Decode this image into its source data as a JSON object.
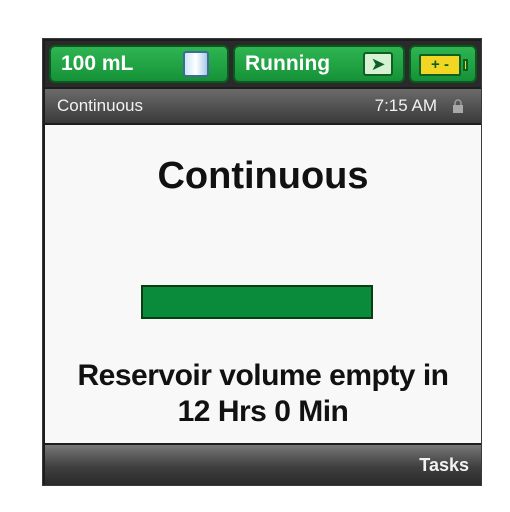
{
  "status_bar": {
    "volume": "100 mL",
    "volume_icon": "reservoir-icon",
    "state": "Running",
    "state_icon": "running-icon",
    "battery_icon": "battery-icon",
    "battery_symbols": "+ -"
  },
  "title_bar": {
    "mode": "Continuous",
    "time": "7:15 AM",
    "lock_icon": "lock-icon"
  },
  "main": {
    "heading": "Continuous",
    "progress": 1.0,
    "message_line1": "Reservoir volume empty in",
    "message_line2": "12 Hrs 0 Min"
  },
  "softkeys": {
    "right": "Tasks"
  },
  "colors": {
    "status_green": "#2fb552",
    "progress_green": "#0a8a3b",
    "battery_yellow": "#f2d624"
  }
}
